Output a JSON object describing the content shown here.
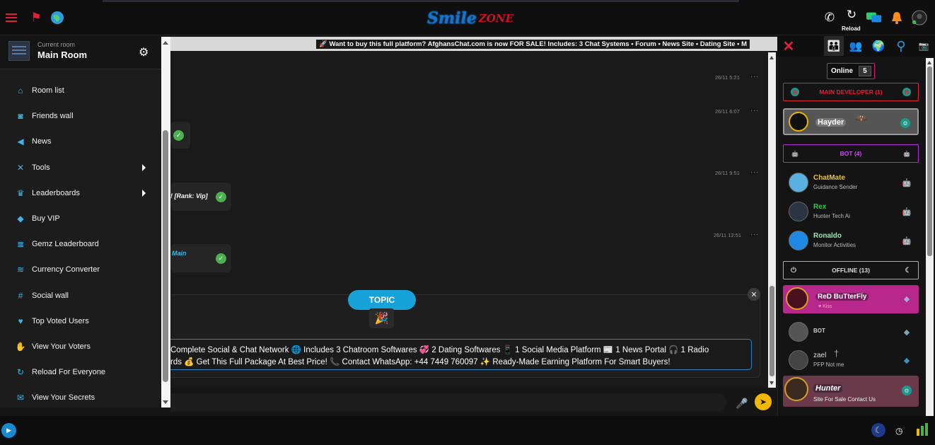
{
  "header": {
    "logo_main": "Smile",
    "logo_sub": "ZONE",
    "reload_label": "Reload"
  },
  "sidebar": {
    "current_room_caption": "Current room",
    "room_name": "Main Room",
    "items": [
      {
        "label": "Room list",
        "icon": "home-icon",
        "glyph": "⌂",
        "submenu": false
      },
      {
        "label": "Friends wall",
        "icon": "rss-icon",
        "glyph": "◙",
        "submenu": false
      },
      {
        "label": "News",
        "icon": "megaphone-icon",
        "glyph": "◀",
        "submenu": false
      },
      {
        "label": "Tools",
        "icon": "tools-icon",
        "glyph": "✕",
        "submenu": true
      },
      {
        "label": "Leaderboards",
        "icon": "trophy-icon",
        "glyph": "♛",
        "submenu": true
      },
      {
        "label": "Buy VIP",
        "icon": "diamond-icon",
        "glyph": "◆",
        "submenu": false
      },
      {
        "label": "Gemz Leaderboard",
        "icon": "database-icon",
        "glyph": "≣",
        "submenu": false
      },
      {
        "label": "Currency Converter",
        "icon": "coins-icon",
        "glyph": "≋",
        "submenu": false
      },
      {
        "label": "Social wall",
        "icon": "hashtag-icon",
        "glyph": "#",
        "submenu": false
      },
      {
        "label": "Top Voted Users",
        "icon": "heart-icon",
        "glyph": "♥",
        "submenu": false
      },
      {
        "label": "View Your Voters",
        "icon": "thumbs-up-icon",
        "glyph": "✋",
        "submenu": false
      },
      {
        "label": "Reload For Everyone",
        "icon": "sync-icon",
        "glyph": "↻",
        "submenu": false
      },
      {
        "label": "View Your Secrets",
        "icon": "envelope-icon",
        "glyph": "✉",
        "submenu": false
      }
    ]
  },
  "marquee": {
    "text": "🚀 Want to buy this full platform? AfghansChat.com is now FOR SALE! Includes: 3 Chat Systems • Forum • News Site • Dating Site • M"
  },
  "chat": {
    "messages": [
      {
        "time": "26/11 5:21"
      },
      {
        "time": "26/11 6:07"
      },
      {
        "time": "26/11 9:51",
        "text": "! [Rank: Vip]"
      },
      {
        "time": "26/11 12:51",
        "text": "Main"
      }
    ]
  },
  "topic": {
    "button_label": "TOPIC",
    "close_label": "✕",
    "line1": "Complete Social & Chat Network 🌐 Includes 3 Chatroom Softwares 💞 2 Dating Softwares 📱 1 Social Media Platform 📰 1 News Portal 🎧 1 Radio",
    "line2": "rds 💰 Get This Full Package At Best Price! 📞 Contact WhatsApp: +44 7449 760097 ✨ Ready-Made Earning Platform For Smart Buyers!"
  },
  "userlist": {
    "online_label": "Online",
    "online_count": "5",
    "groups": {
      "developer": "MAIN DEVELOPER (1)",
      "bot": "BOT (4)",
      "offline": "OFFLINE (13)"
    },
    "users": [
      {
        "name": "Hayder",
        "mood": "",
        "color": "#ffffff"
      },
      {
        "name": "ChatMate",
        "mood": "Guidance Sender",
        "color": "#f0c420"
      },
      {
        "name": "Rex",
        "mood": "Hunter Tech Ai",
        "color": "#2ecc40"
      },
      {
        "name": "Ronaldo",
        "mood": "Monitor Activities",
        "color": "#9ae6b4"
      },
      {
        "name": "ReD BuTterFly",
        "mood": "♥ Kiss",
        "color": "#ffffff"
      },
      {
        "name": "BOT",
        "mood": "",
        "color": "#cccccc"
      },
      {
        "name": "zael",
        "mood": "PFP Not me",
        "color": "#dddddd"
      },
      {
        "name": "Hunter",
        "mood": "Site For Sale Contact Us",
        "color": "#ffffff"
      }
    ]
  },
  "colors": {
    "accent_red": "#e0213a",
    "topic_blue": "#17a3d9",
    "online_pink": "#e0167a",
    "send_yellow": "#f5b800"
  }
}
